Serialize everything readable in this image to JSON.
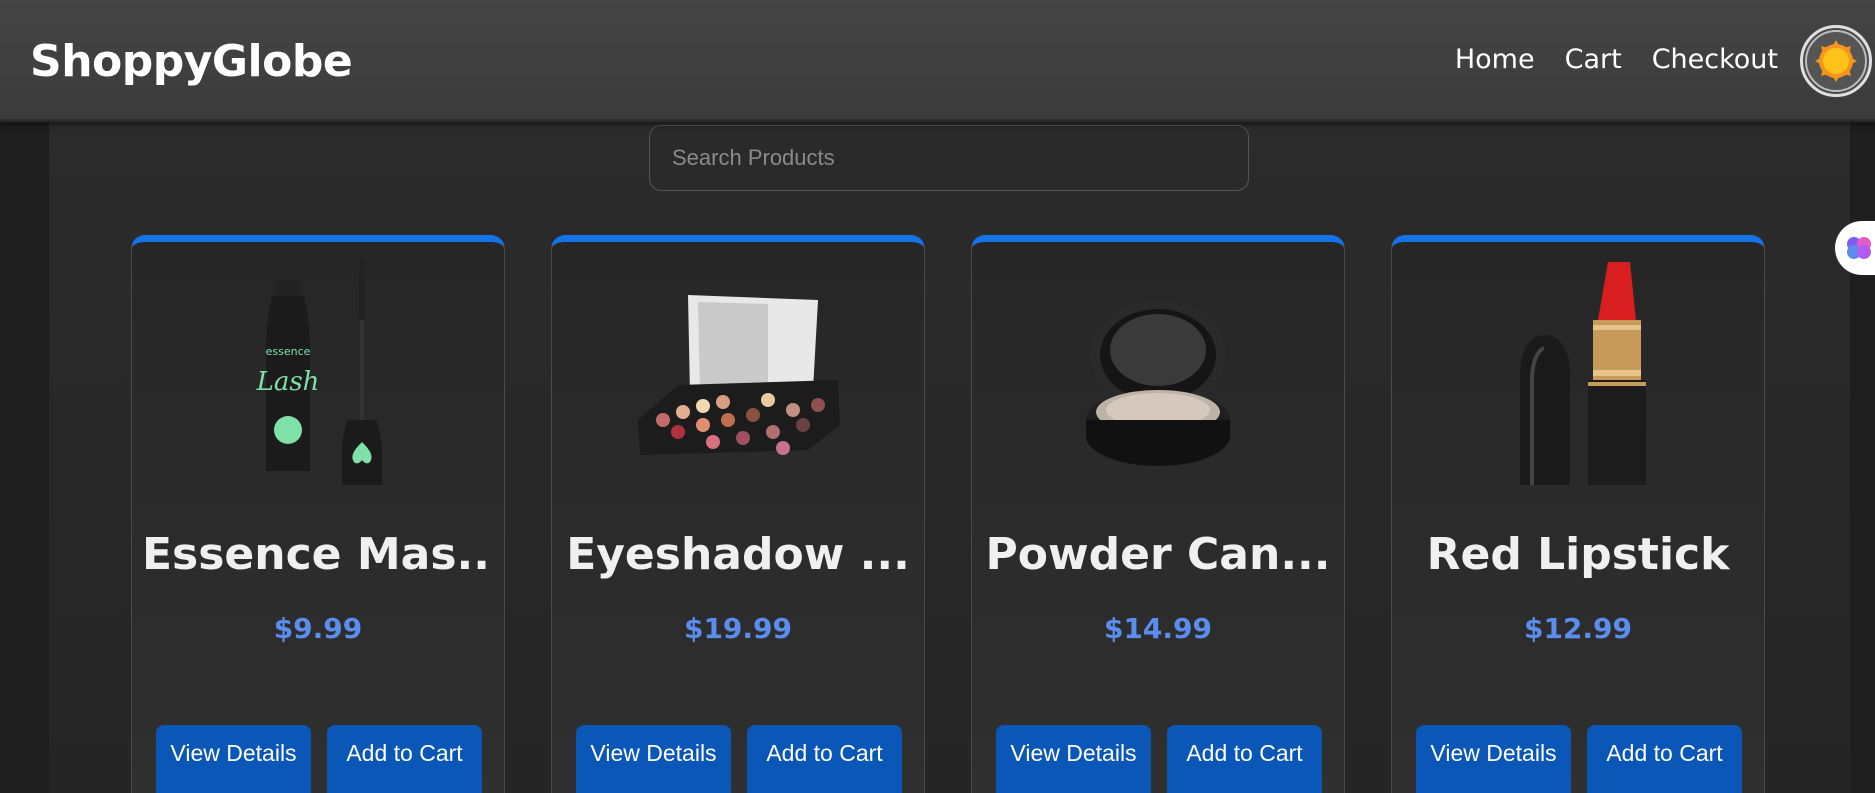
{
  "app": {
    "brand": "ShoppyGlobe"
  },
  "nav": {
    "links": [
      "Home",
      "Cart",
      "Checkout"
    ]
  },
  "search": {
    "placeholder": "Search Products",
    "value": ""
  },
  "colors": {
    "accent": "#1473e6",
    "price": "#5b8def",
    "button": "#0b57b8"
  },
  "products": [
    {
      "title": "Essence Mas...",
      "price": "$9.99",
      "icon": "mascara-icon",
      "view_label": "View Details",
      "cart_label": "Add to Cart"
    },
    {
      "title": "Eyeshadow ...",
      "price": "$19.99",
      "icon": "eyeshadow-palette-icon",
      "view_label": "View Details",
      "cart_label": "Add to Cart"
    },
    {
      "title": "Powder Can...",
      "price": "$14.99",
      "icon": "powder-compact-icon",
      "view_label": "View Details",
      "cart_label": "Add to Cart"
    },
    {
      "title": "Red Lipstick",
      "price": "$12.99",
      "icon": "lipstick-icon",
      "view_label": "View Details",
      "cart_label": "Add to Cart"
    }
  ]
}
